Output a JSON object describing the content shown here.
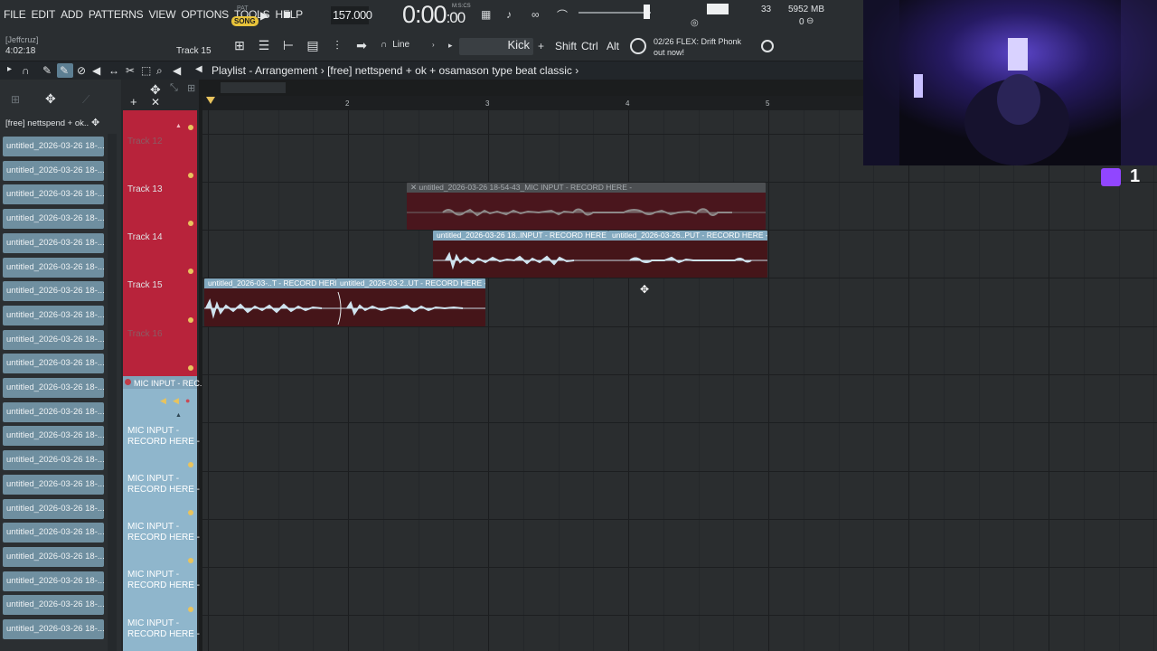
{
  "menu": [
    "FILE",
    "EDIT",
    "ADD",
    "PATTERNS",
    "VIEW",
    "OPTIONS",
    "TOOLS",
    "HELP"
  ],
  "transport": {
    "mode_pat": "PAT",
    "mode_song": "SONG",
    "tempo": "157.000",
    "time_main": "0:00",
    "time_ms": ":00",
    "time_unit": "M:S:CS"
  },
  "status": {
    "cpu": "33",
    "memory": "5952 MB",
    "polyphony": "0"
  },
  "user": "[Jeffcruz]",
  "clock": "4:02:18",
  "current_track": "Track 15",
  "snap": "Line",
  "instrument": "Kick",
  "keys": [
    "Shift",
    "Ctrl",
    "Alt"
  ],
  "news": {
    "line1": "02/26  FLEX: Drift Phonk",
    "line2": "out now!"
  },
  "playlist": {
    "title": "Playlist - Arrangement",
    "separator": "›",
    "project": "[free] nettspend + ok + osamason type beat classic"
  },
  "browser": {
    "path": "[free] nettspend + ok..",
    "items": [
      "untitled_2026-03-26 18-...",
      "untitled_2026-03-26 18-...",
      "untitled_2026-03-26 18-...",
      "untitled_2026-03-26 18-...",
      "untitled_2026-03-26 18-...",
      "untitled_2026-03-26 18-...",
      "untitled_2026-03-26 18-...",
      "untitled_2026-03-26 18-...",
      "untitled_2026-03-26 18-...",
      "untitled_2026-03-26 18-...",
      "untitled_2026-03-26 18-...",
      "untitled_2026-03-26 18-...",
      "untitled_2026-03-26 18-...",
      "untitled_2026-03-26 18-...",
      "untitled_2026-03-26 18-...",
      "untitled_2026-03-26 18-...",
      "untitled_2026-03-26 18-...",
      "untitled_2026-03-26 18-...",
      "untitled_2026-03-26 18-...",
      "untitled_2026-03-26 18-...",
      "untitled_2026-03-26 18-..."
    ]
  },
  "tracks": {
    "t12": "Track 12",
    "t13": "Track 13",
    "t14": "Track 14",
    "t15": "Track 15",
    "t16": "Track 16",
    "mic_header": "MIC INPUT - REC...",
    "mic_line1": "MIC INPUT -",
    "mic_line2": "RECORD HERE -"
  },
  "ruler": [
    "2",
    "3",
    "4",
    "5"
  ],
  "clips": {
    "c13": "untitled_2026-03-26 18-54-43_MIC INPUT - RECORD HERE -",
    "c14a": "untitled_2026-03-26 18..INPUT - RECORD HERE -",
    "c14b": "untitled_2026-03-26..PUT - RECORD HERE -",
    "c15a": "untitled_2026-03-..T - RECORD HERE",
    "c15b": "untitled_2026-03-2..UT - RECORD HERE -"
  },
  "overlay": {
    "twitch_count": "1"
  },
  "colors": {
    "track_red": "#b8233b",
    "track_blue": "#8fb6cc",
    "record": "#e8505b",
    "song_badge": "#e8c33a"
  }
}
